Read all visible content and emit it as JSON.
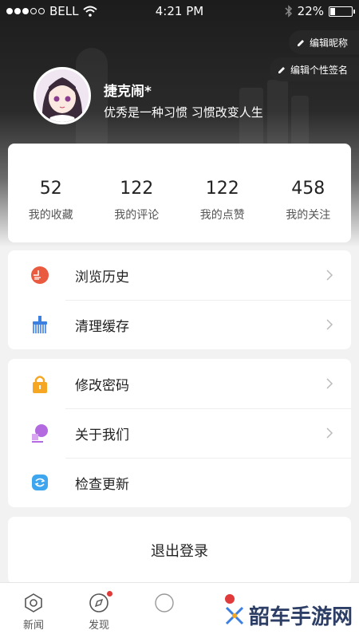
{
  "status_bar": {
    "carrier": "BELL",
    "time": "4:21 PM",
    "battery": "22%",
    "battery_level": 0.22
  },
  "header": {
    "edit_nickname": "编辑昵称",
    "edit_signature": "编辑个性签名",
    "nickname": "捷克闹*",
    "signature": "优秀是一种习惯 习惯改变人生"
  },
  "stats": [
    {
      "value": "52",
      "label": "我的收藏"
    },
    {
      "value": "122",
      "label": "我的评论"
    },
    {
      "value": "122",
      "label": "我的点赞"
    },
    {
      "value": "458",
      "label": "我的关注"
    }
  ],
  "menu_group_1": [
    {
      "label": "浏览历史",
      "icon": "history-icon"
    },
    {
      "label": "清理缓存",
      "icon": "broom-icon"
    }
  ],
  "menu_group_2": [
    {
      "label": "修改密码",
      "icon": "lock-icon"
    },
    {
      "label": "关于我们",
      "icon": "about-icon"
    },
    {
      "label": "检查更新",
      "icon": "update-icon"
    }
  ],
  "logout_label": "退出登录",
  "tabs": [
    {
      "label": "新闻",
      "icon": "news-icon"
    },
    {
      "label": "发现",
      "icon": "compass-icon"
    }
  ],
  "watermark": "韶车手游网",
  "colors": {
    "accent_red": "#e03a3a",
    "lock_orange": "#f5a623",
    "broom_blue": "#3b7fe0"
  }
}
